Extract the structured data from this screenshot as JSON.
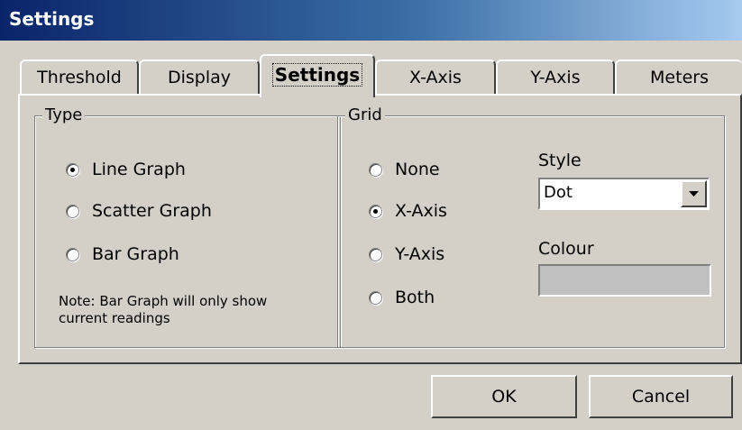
{
  "window": {
    "title": "Settings"
  },
  "tabs": [
    {
      "label": "Threshold",
      "active": false
    },
    {
      "label": "Display",
      "active": false
    },
    {
      "label": "Settings",
      "active": true
    },
    {
      "label": "X-Axis",
      "active": false
    },
    {
      "label": "Y-Axis",
      "active": false
    },
    {
      "label": "Meters",
      "active": false
    }
  ],
  "type_group": {
    "legend": "Type",
    "options": [
      {
        "label": "Line Graph",
        "checked": true
      },
      {
        "label": "Scatter Graph",
        "checked": false
      },
      {
        "label": "Bar Graph",
        "checked": false
      }
    ],
    "note": "Note: Bar Graph will only show current readings"
  },
  "grid_group": {
    "legend": "Grid",
    "options": [
      {
        "label": "None",
        "checked": false
      },
      {
        "label": "X-Axis",
        "checked": true
      },
      {
        "label": "Y-Axis",
        "checked": false
      },
      {
        "label": "Both",
        "checked": false
      }
    ],
    "style_label": "Style",
    "style_value": "Dot",
    "colour_label": "Colour",
    "colour_value": "#c0c0c0"
  },
  "buttons": {
    "ok": "OK",
    "cancel": "Cancel"
  },
  "colors": {
    "face": "#d4d0c8",
    "title_start": "#0a246a",
    "title_end": "#a6caf0"
  }
}
